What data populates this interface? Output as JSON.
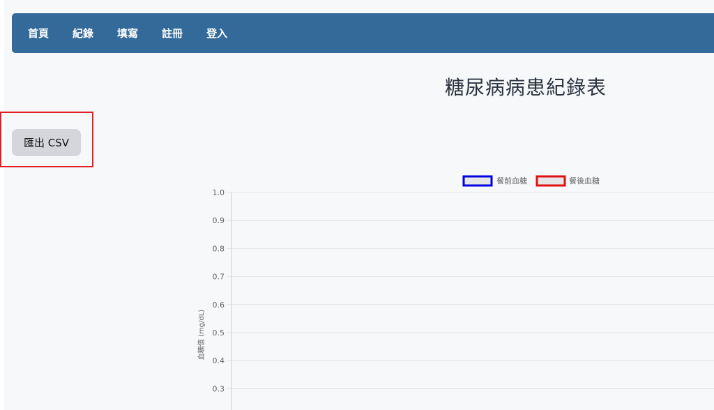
{
  "nav": {
    "items": [
      {
        "label": "首頁"
      },
      {
        "label": "紀錄"
      },
      {
        "label": "填寫"
      },
      {
        "label": "註冊"
      },
      {
        "label": "登入"
      }
    ]
  },
  "page": {
    "title": "糖尿病病患紀錄表"
  },
  "actions": {
    "export_label": "匯出 CSV"
  },
  "chart_data": {
    "type": "line",
    "title": "",
    "xlabel": "",
    "ylabel": "血糖值 (mg/dL)",
    "ylim": [
      0,
      1
    ],
    "y_ticks": [
      "1.0",
      "0.9",
      "0.8",
      "0.7",
      "0.6",
      "0.5",
      "0.4",
      "0.3"
    ],
    "legend_position": "top",
    "grid": true,
    "series": [
      {
        "name": "餐前血糖",
        "color": "#0000e0",
        "values": []
      },
      {
        "name": "餐後血糖",
        "color": "#e01010",
        "values": []
      }
    ]
  }
}
